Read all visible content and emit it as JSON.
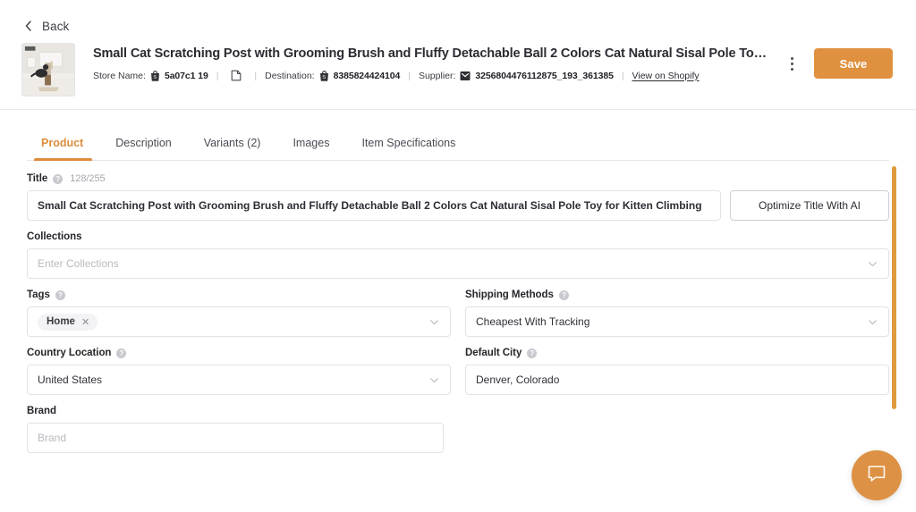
{
  "header": {
    "back_label": "Back",
    "product_title": "Small Cat Scratching Post with Grooming Brush and Fluffy Detachable Ball 2 Colors Cat Natural Sisal Pole Toy for Kitten...",
    "meta": {
      "store_name_label": "Store Name:",
      "store_name_value": "5a07c1 19",
      "destination_label": "Destination:",
      "destination_value": "8385824424104",
      "supplier_label": "Supplier:",
      "supplier_value": "3256804476112875_193_361385",
      "view_on_shopify": "View on Shopify"
    },
    "save_label": "Save"
  },
  "tabs": [
    {
      "label": "Product",
      "active": true
    },
    {
      "label": "Description",
      "active": false
    },
    {
      "label": "Variants (2)",
      "active": false
    },
    {
      "label": "Images",
      "active": false
    },
    {
      "label": "Item Specifications",
      "active": false
    }
  ],
  "form": {
    "title": {
      "label": "Title",
      "counter": "128/255",
      "value": "Small Cat Scratching Post with Grooming Brush and Fluffy Detachable Ball 2 Colors Cat Natural Sisal Pole Toy for Kitten Climbing",
      "optimize_button": "Optimize Title With AI"
    },
    "collections": {
      "label": "Collections",
      "placeholder": "Enter Collections",
      "value": ""
    },
    "tags": {
      "label": "Tags",
      "chips": [
        "Home"
      ]
    },
    "shipping_methods": {
      "label": "Shipping Methods",
      "value": "Cheapest With Tracking"
    },
    "country_location": {
      "label": "Country Location",
      "value": "United States"
    },
    "default_city": {
      "label": "Default City",
      "value": "Denver, Colorado"
    },
    "brand": {
      "label": "Brand",
      "placeholder": "Brand",
      "value": ""
    }
  },
  "help_glyph": "?",
  "colors": {
    "accent": "#dd8d3c",
    "save_button": "#e0913f",
    "scrollbar": "#e0993f",
    "chat_fab": "#dd9144"
  }
}
